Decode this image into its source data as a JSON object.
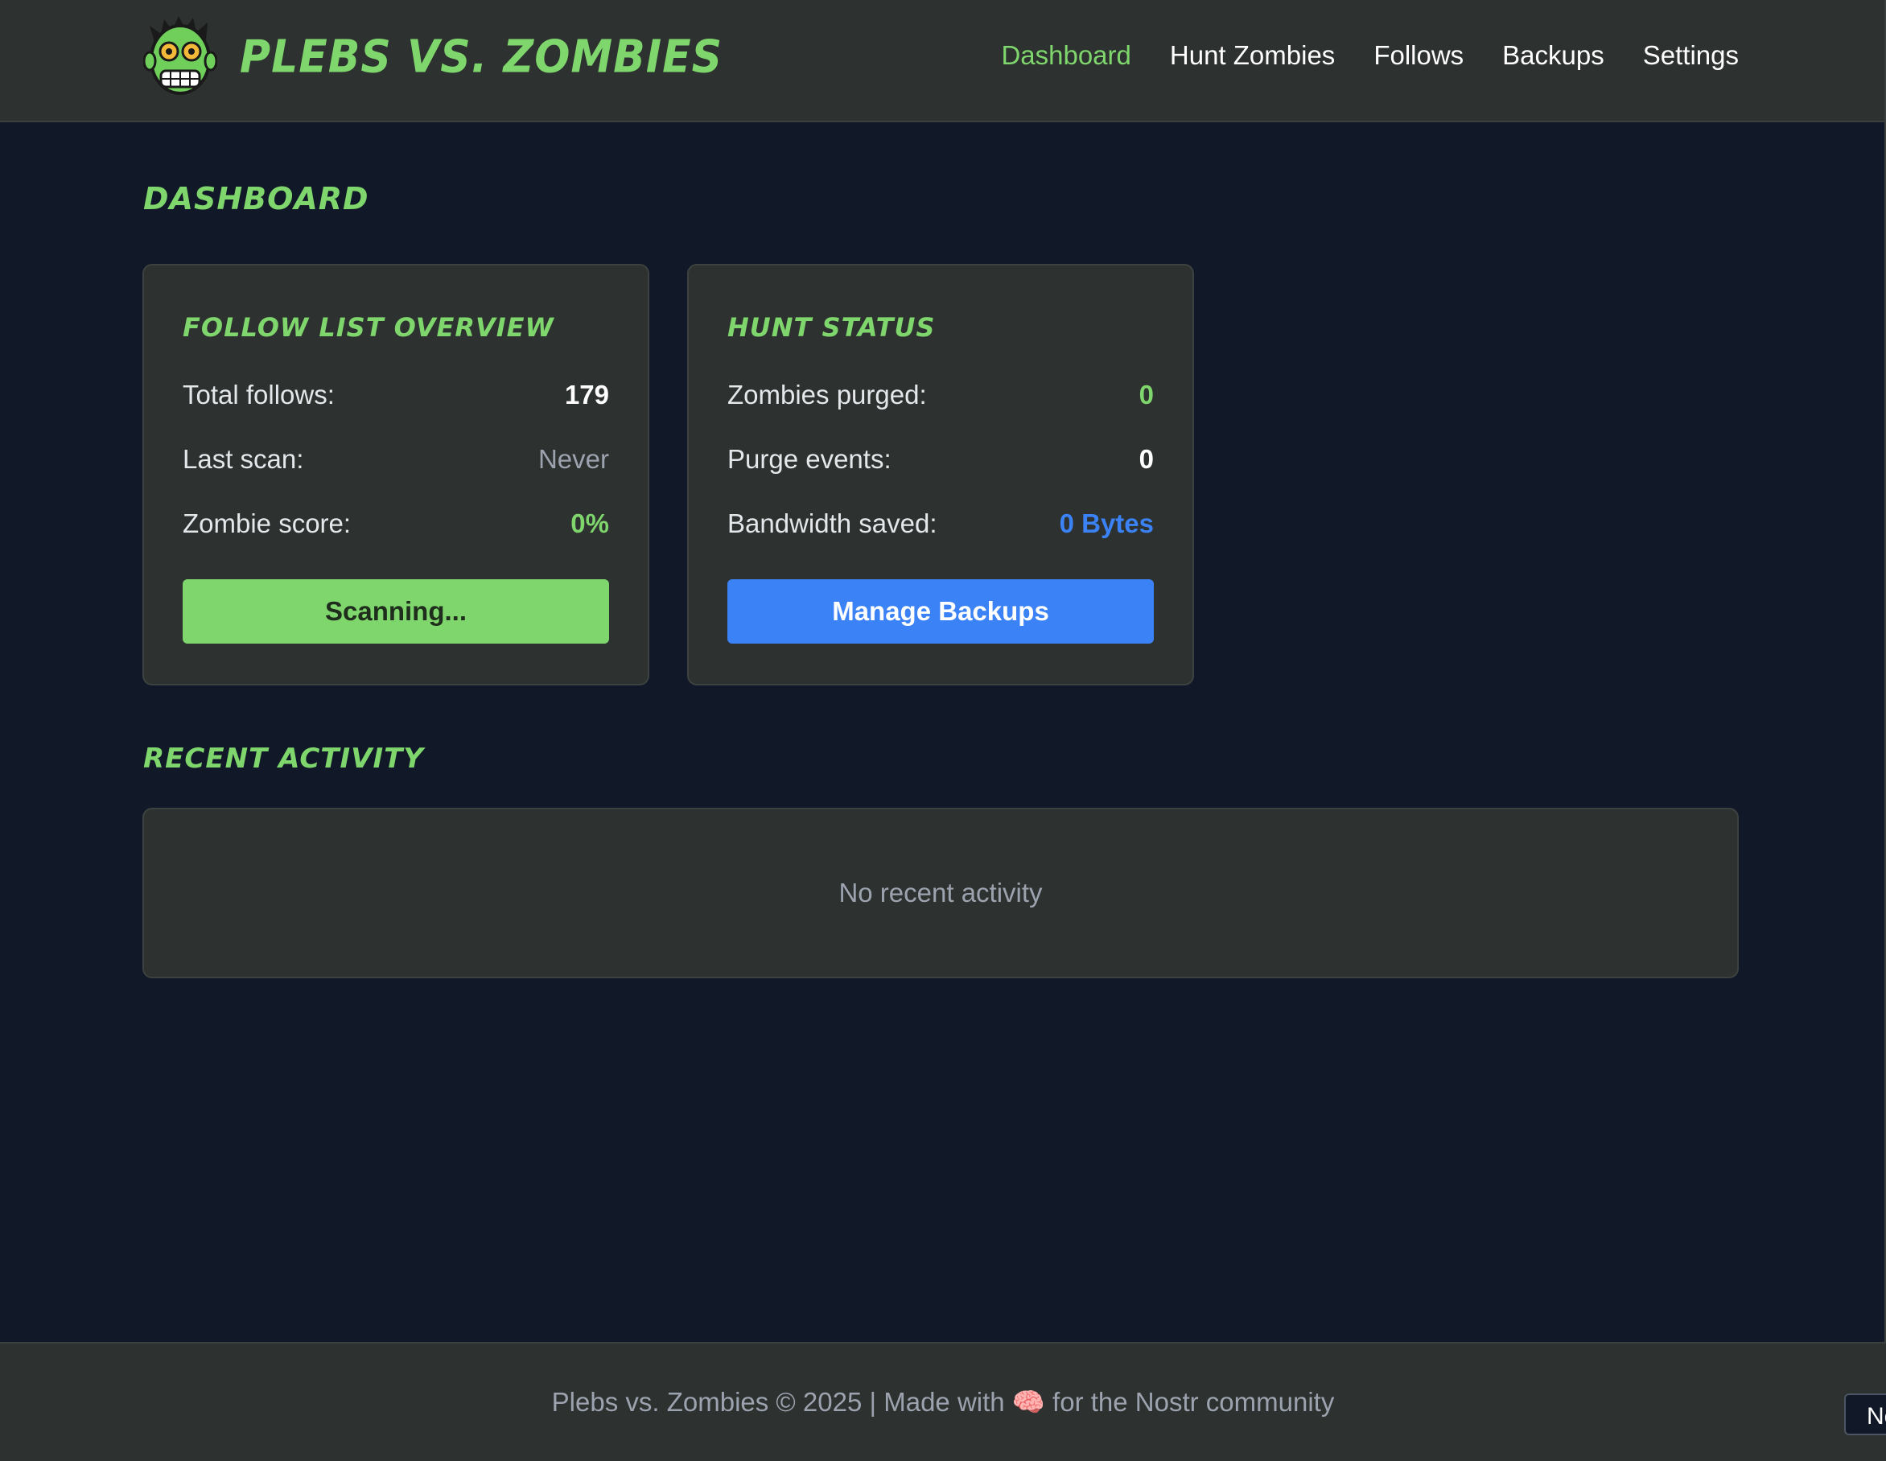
{
  "header": {
    "brand": "PLEBS VS. ZOMBIES",
    "logo_icon": "zombie-face-icon",
    "nav": [
      {
        "label": "Dashboard",
        "active": true
      },
      {
        "label": "Hunt Zombies",
        "active": false
      },
      {
        "label": "Follows",
        "active": false
      },
      {
        "label": "Backups",
        "active": false
      },
      {
        "label": "Settings",
        "active": false
      }
    ]
  },
  "page": {
    "title": "DASHBOARD"
  },
  "follow_card": {
    "title": "FOLLOW LIST OVERVIEW",
    "total_follows_label": "Total follows:",
    "total_follows_value": "179",
    "last_scan_label": "Last scan:",
    "last_scan_value": "Never",
    "zombie_score_label": "Zombie score:",
    "zombie_score_value": "0%",
    "button_label": "Scanning..."
  },
  "hunt_card": {
    "title": "HUNT STATUS",
    "zombies_purged_label": "Zombies purged:",
    "zombies_purged_value": "0",
    "purge_events_label": "Purge events:",
    "purge_events_value": "0",
    "bandwidth_label": "Bandwidth saved:",
    "bandwidth_value": "0 Bytes",
    "button_label": "Manage Backups"
  },
  "activity": {
    "title": "RECENT ACTIVITY",
    "empty_text": "No recent activity"
  },
  "footer": {
    "text": "Plebs vs. Zombies © 2025 | Made with 🧠 for the Nostr community"
  },
  "toast": {
    "text": "Ne"
  },
  "colors": {
    "accent_green": "#7ed66c",
    "accent_blue": "#3b82f6",
    "background": "#111827",
    "panel": "#2d312f"
  }
}
